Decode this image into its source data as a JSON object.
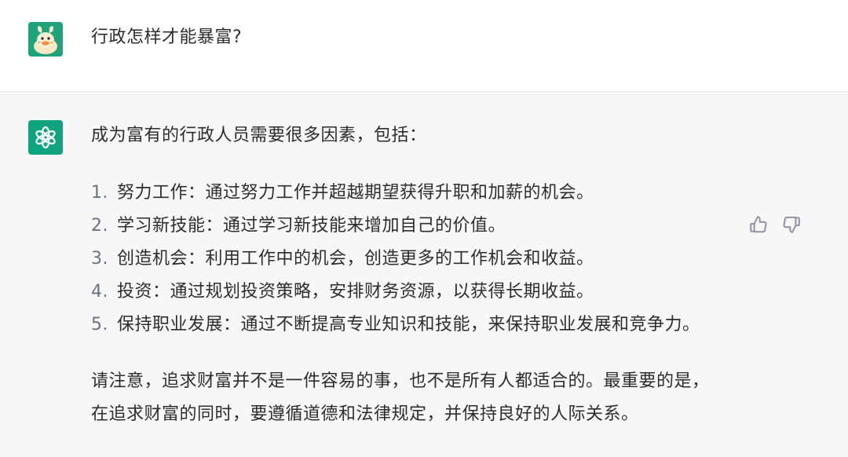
{
  "user_message": {
    "avatar_icon": "duck-avatar-icon",
    "text": "行政怎样才能暴富?"
  },
  "assistant_message": {
    "avatar_icon": "openai-logo-icon",
    "intro": "成为富有的行政人员需要很多因素，包括：",
    "points": [
      {
        "num": "1.",
        "text": "努力工作：通过努力工作并超越期望获得升职和加薪的机会。"
      },
      {
        "num": "2.",
        "text": "学习新技能：通过学习新技能来增加自己的价值。"
      },
      {
        "num": "3.",
        "text": "创造机会：利用工作中的机会，创造更多的工作机会和收益。"
      },
      {
        "num": "4.",
        "text": "投资：通过规划投资策略，安排财务资源，以获得长期收益。"
      },
      {
        "num": "5.",
        "text": "保持职业发展：通过不断提高专业知识和技能，来保持职业发展和竞争力。"
      }
    ],
    "closing": "请注意，追求财富并不是一件容易的事，也不是所有人都适合的。最重要的是，在追求财富的同时，要遵循道德和法律规定，并保持良好的人际关系。"
  },
  "feedback": {
    "like_icon": "thumbs-up-icon",
    "dislike_icon": "thumbs-down-icon"
  },
  "colors": {
    "user_bg": "#ffffff",
    "assistant_bg": "#f7f7f8",
    "brand_green": "#10a37f",
    "text": "#2d2d2d"
  }
}
